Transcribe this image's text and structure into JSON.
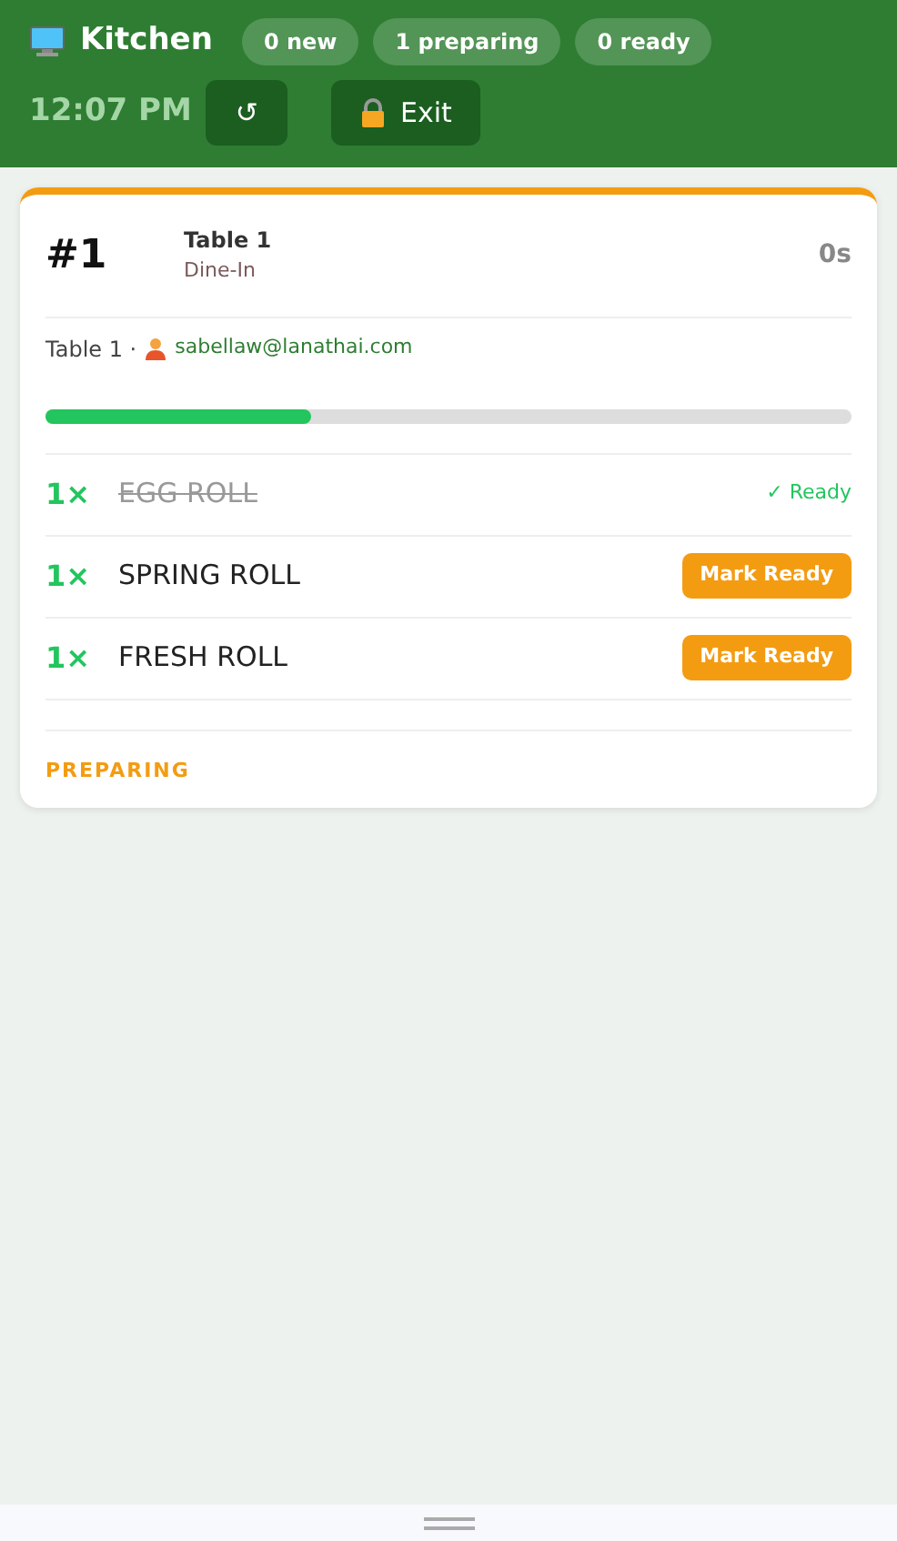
{
  "header": {
    "title": "Kitchen",
    "counts": [
      "0 new",
      "1 preparing",
      "0 ready"
    ],
    "time": "12:07 PM",
    "refresh": "↺",
    "exit": "Exit"
  },
  "order": {
    "number": "#1",
    "table": "Table 1",
    "type": "Dine-In",
    "elapsed": "0s",
    "location": "Table 1 ·",
    "user": "sabellaw@lanathai.com",
    "level": 0.33,
    "items": [
      {
        "qty": "1×",
        "name": "EGG ROLL",
        "ready": true,
        "action": "✓ Ready"
      },
      {
        "qty": "1×",
        "name": "SPRING ROLL",
        "ready": false,
        "action": "Mark Ready"
      },
      {
        "qty": "1×",
        "name": "FRESH ROLL",
        "ready": false,
        "action": "Mark Ready"
      }
    ],
    "status": "PREPARING"
  }
}
